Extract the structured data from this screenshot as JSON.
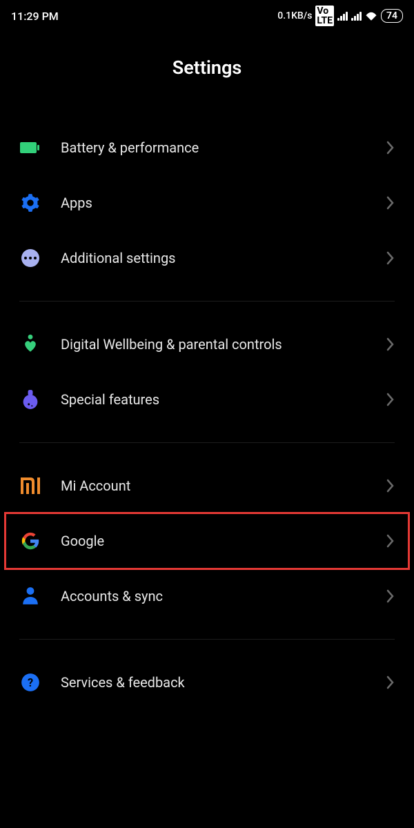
{
  "status": {
    "time": "11:29 PM",
    "net_speed": "0.1KB/s",
    "volte": "Vo LTE",
    "battery": "74"
  },
  "header": {
    "title": "Settings"
  },
  "groups": [
    {
      "items": [
        {
          "id": "battery-performance",
          "label": "Battery & performance",
          "icon": "battery-icon",
          "color": "#32d07a"
        },
        {
          "id": "apps",
          "label": "Apps",
          "icon": "gear-icon",
          "color": "#1b6ff3"
        },
        {
          "id": "additional-settings",
          "label": "Additional settings",
          "icon": "ellipsis-icon",
          "color": "#a8b1f0"
        }
      ]
    },
    {
      "items": [
        {
          "id": "digital-wellbeing",
          "label": "Digital Wellbeing & parental controls",
          "icon": "heart-person-icon",
          "color": "#36cf7c"
        },
        {
          "id": "special-features",
          "label": "Special features",
          "icon": "flask-icon",
          "color": "#6b5cf0"
        }
      ]
    },
    {
      "items": [
        {
          "id": "mi-account",
          "label": "Mi Account",
          "icon": "mi-logo-icon",
          "color": "#f08c2d"
        },
        {
          "id": "google",
          "label": "Google",
          "icon": "google-logo-icon",
          "color": "",
          "highlighted": true
        },
        {
          "id": "accounts-sync",
          "label": "Accounts & sync",
          "icon": "person-icon",
          "color": "#1b6ff3"
        }
      ]
    },
    {
      "items": [
        {
          "id": "services-feedback",
          "label": "Services & feedback",
          "icon": "help-icon",
          "color": "#1b6ff3"
        }
      ]
    }
  ]
}
